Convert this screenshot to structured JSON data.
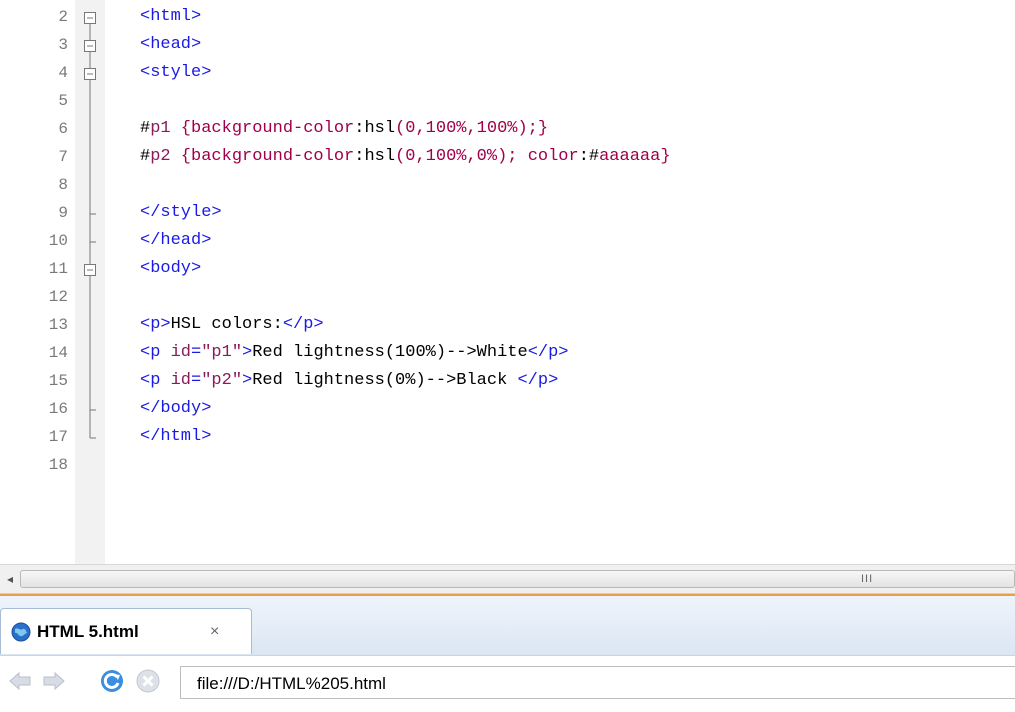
{
  "editor": {
    "lines": [
      {
        "n": "2",
        "fold": "box",
        "segs": [
          [
            "tag",
            "<html>"
          ]
        ]
      },
      {
        "n": "3",
        "fold": "box",
        "segs": [
          [
            "tag",
            "<head>"
          ]
        ]
      },
      {
        "n": "4",
        "fold": "box",
        "segs": [
          [
            "tag",
            "<style>"
          ]
        ]
      },
      {
        "n": "5",
        "fold": "line",
        "segs": []
      },
      {
        "n": "6",
        "fold": "line",
        "segs": [
          [
            "hash",
            "#"
          ],
          [
            "sel",
            "p1"
          ],
          [
            "punc",
            " {"
          ],
          [
            "prop",
            "background-color"
          ],
          [
            "hash",
            ":hsl"
          ],
          [
            "punc",
            "(0,100%,100%);}"
          ]
        ]
      },
      {
        "n": "7",
        "fold": "line",
        "segs": [
          [
            "hash",
            "#"
          ],
          [
            "sel",
            "p2"
          ],
          [
            "punc",
            " {"
          ],
          [
            "prop",
            "background-color"
          ],
          [
            "hash",
            ":hsl"
          ],
          [
            "punc",
            "(0,100%,0%); "
          ],
          [
            "prop",
            "color"
          ],
          [
            "hash",
            ":#"
          ],
          [
            "punc",
            "aaaaaa}"
          ]
        ]
      },
      {
        "n": "8",
        "fold": "line",
        "segs": []
      },
      {
        "n": "9",
        "fold": "tee",
        "segs": [
          [
            "tag",
            "</style>"
          ]
        ]
      },
      {
        "n": "10",
        "fold": "tee",
        "segs": [
          [
            "tag",
            "</head>"
          ]
        ]
      },
      {
        "n": "11",
        "fold": "box",
        "segs": [
          [
            "tag",
            "<body>"
          ]
        ]
      },
      {
        "n": "12",
        "fold": "line",
        "segs": []
      },
      {
        "n": "13",
        "fold": "line",
        "segs": [
          [
            "tag",
            "<p>"
          ],
          [
            "hash",
            "HSL colors:"
          ],
          [
            "tag",
            "</p>"
          ]
        ]
      },
      {
        "n": "14",
        "fold": "line",
        "segs": [
          [
            "tag",
            "<p "
          ],
          [
            "attr",
            "id"
          ],
          [
            "tag",
            "="
          ],
          [
            "str",
            "\"p1\""
          ],
          [
            "tag",
            ">"
          ],
          [
            "hash",
            "Red lightness(100%)-->White"
          ],
          [
            "tag",
            "</p>"
          ]
        ]
      },
      {
        "n": "15",
        "fold": "line",
        "segs": [
          [
            "tag",
            "<p "
          ],
          [
            "attr",
            "id"
          ],
          [
            "tag",
            "="
          ],
          [
            "str",
            "\"p2\""
          ],
          [
            "tag",
            ">"
          ],
          [
            "hash",
            "Red lightness(0%)-->Black "
          ],
          [
            "tag",
            "</p>"
          ]
        ]
      },
      {
        "n": "16",
        "fold": "tee",
        "segs": [
          [
            "tag",
            "</body>"
          ]
        ]
      },
      {
        "n": "17",
        "fold": "end",
        "segs": [
          [
            "tag",
            "</html>"
          ]
        ]
      },
      {
        "n": "18",
        "fold": "none",
        "segs": []
      }
    ]
  },
  "scrollbar": {
    "left_arrow": "◂",
    "grip": "III"
  },
  "browser": {
    "tab_title": "HTML 5.html",
    "tab_close": "×",
    "url": "file:///D:/HTML%205.html"
  }
}
